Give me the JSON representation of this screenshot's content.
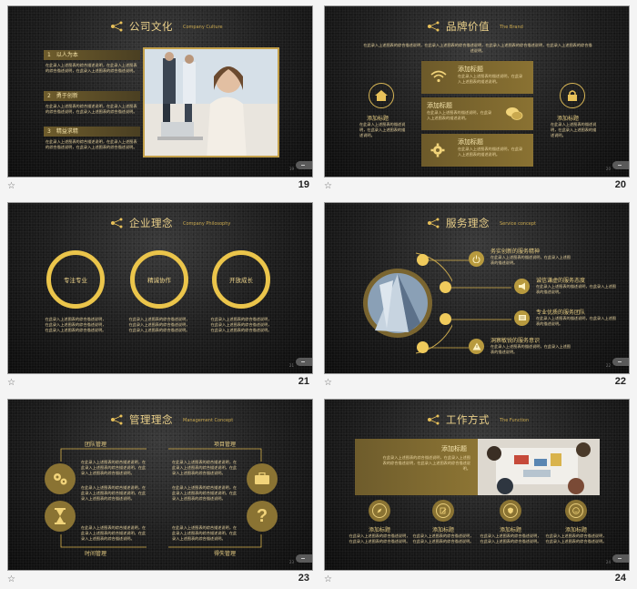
{
  "placeholder": "在此录入上述图表的综合描述说明，在此录入上述图表的综合描述说明。",
  "s19": {
    "number": "19",
    "title": "公司文化",
    "subtitle": "Company Culture",
    "items": [
      {
        "n": "1",
        "label": "以人为本",
        "text": "在此录入上述图表的综合描述说明，在此录入上述图表的综合描述说明，在此录入上述图表的综合描述说明。"
      },
      {
        "n": "2",
        "label": "勇于创新",
        "text": "在此录入上述图表的综合描述说明，在此录入上述图表的综合描述说明，在此录入上述图表的综合描述说明。"
      },
      {
        "n": "3",
        "label": "精益求精",
        "text": "在此录入上述图表的综合描述说明，在此录入上述图表的综合描述说明，在此录入上述图表的综合描述说明。"
      }
    ]
  },
  "s20": {
    "number": "20",
    "title": "品牌价值",
    "subtitle": "The Brand",
    "intro": "在此录入上述图表的综合描述说明，在此录入上述图表的综合描述说明，在此录入上述图表的综合描述说明，在此录入上述图表的综合描述说明。",
    "side_title": "添加标题",
    "side_text": "在此录入上述图表的描述说明，在此录入上述图表的描述说明。",
    "box_title": "添加标题",
    "box_text": "在此录入上述图表的描述说明，在此录入上述图表的描述说明。"
  },
  "s21": {
    "number": "21",
    "title": "企业理念",
    "subtitle": "Company Philosophy",
    "rings": [
      "专注专业",
      "精诚协作",
      "开放成长"
    ],
    "text": "在此录入上述图表的综合描述说明，在此录入上述图表的综合描述说明，在此录入上述图表的综合描述说明。"
  },
  "s22": {
    "number": "22",
    "title": "服务理念",
    "subtitle": "Service concept",
    "items": [
      {
        "label": "务实创新的服务精神",
        "text": "在此录入上述图表的描述说明，在此录入上述图表的描述说明。"
      },
      {
        "label": "诚信谦虚的服务态度",
        "text": "在此录入上述图表的描述说明，在此录入上述图表的描述说明。"
      },
      {
        "label": "专业优质的服务团队",
        "text": "在此录入上述图表的描述说明，在此录入上述图表的描述说明。"
      },
      {
        "label": "洞察敏锐的服务意识",
        "text": "在此录入上述图表的描述说明，在此录入上述图表的描述说明。"
      }
    ]
  },
  "s23": {
    "number": "23",
    "title": "管理理念",
    "subtitle": "Management Concept",
    "labels": [
      "团队管理",
      "项目管理",
      "时间管理",
      "得失管理"
    ],
    "text": "在此录入上述图表的综合描述说明，在此录入上述图表的综合描述说明，在此录入上述图表的综合描述说明。"
  },
  "s24": {
    "number": "24",
    "title": "工作方式",
    "subtitle": "The Function",
    "panel_title": "添加标题",
    "panel_text": "在此录入上述图表的综合描述说明，在此录入上述图表的综合描述说明，在此录入上述图表的综合描述说明。",
    "items_title": "添加标题",
    "items_text": "在此录入上述图表的综合描述说明，在此录入上述图表的综合描述说明。"
  },
  "colors": {
    "gold": "#e8c15a",
    "dark": "#1c1c1c",
    "frame": "#c3a04a"
  },
  "icons": [
    "star-icon",
    "wifi-icon",
    "home-icon",
    "lock-icon",
    "chat-icon",
    "gear-icon",
    "power-icon",
    "megaphone-icon",
    "diploma-icon",
    "warning-icon",
    "briefcase-icon",
    "hourglass-icon",
    "question-icon"
  ]
}
